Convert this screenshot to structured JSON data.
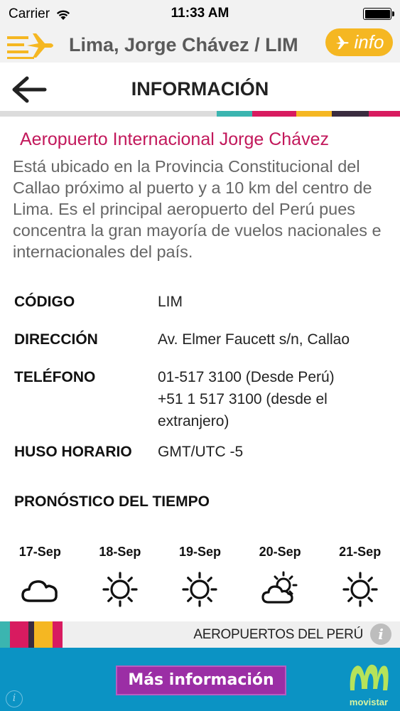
{
  "status_bar": {
    "carrier": "Carrier",
    "time": "11:33 AM",
    "icons": [
      "wifi-icon",
      "battery-icon"
    ]
  },
  "app_bar": {
    "title": "Lima, Jorge Chávez / LIM",
    "info_button_label": "info",
    "menu_icon": "menu-plane-icon",
    "accent_color": "#f5b722"
  },
  "nav": {
    "title": "INFORMACIÓN",
    "back_icon": "back-arrow-icon",
    "stripe_colors": [
      "#3bb5b0",
      "#d81b60",
      "#f5b722",
      "#3a2c3f",
      "#d81b60"
    ]
  },
  "airport": {
    "name": "Aeropuerto Internacional Jorge Chávez",
    "name_color": "#c2185b",
    "description": "Está ubicado en la Provincia Constitucional del Callao próximo al puerto y a 10 km del centro de Lima. Es el principal aeropuerto del Perú pues concentra la gran mayoría de vuelos nacionales e internacionales del país."
  },
  "details": {
    "code_label": "CÓDIGO",
    "code_value": "LIM",
    "address_label": "DIRECCIÓN",
    "address_value": "Av. Elmer Faucett s/n, Callao",
    "phone_label": "TELÉFONO",
    "phone_value_1": "01-517 3100 (Desde Perú)",
    "phone_value_2": "+51 1 517 3100 (desde el",
    "phone_value_3": "extranjero)",
    "timezone_label": "HUSO HORARIO",
    "timezone_value": "GMT/UTC -5"
  },
  "forecast": {
    "title": "PRONÓSTICO DEL TIEMPO",
    "days": [
      {
        "date": "17-Sep",
        "icon": "cloud-icon"
      },
      {
        "date": "18-Sep",
        "icon": "sun-icon"
      },
      {
        "date": "19-Sep",
        "icon": "sun-icon"
      },
      {
        "date": "20-Sep",
        "icon": "partly-cloudy-icon"
      },
      {
        "date": "21-Sep",
        "icon": "sun-icon"
      }
    ]
  },
  "footer": {
    "text": "AEROPUERTOS DEL PERÚ",
    "info_icon": "info-circle-icon"
  },
  "ad": {
    "button_label": "Más información",
    "brand": "movistar",
    "background_color": "#0b93c4",
    "button_color": "#9b2ea5"
  }
}
